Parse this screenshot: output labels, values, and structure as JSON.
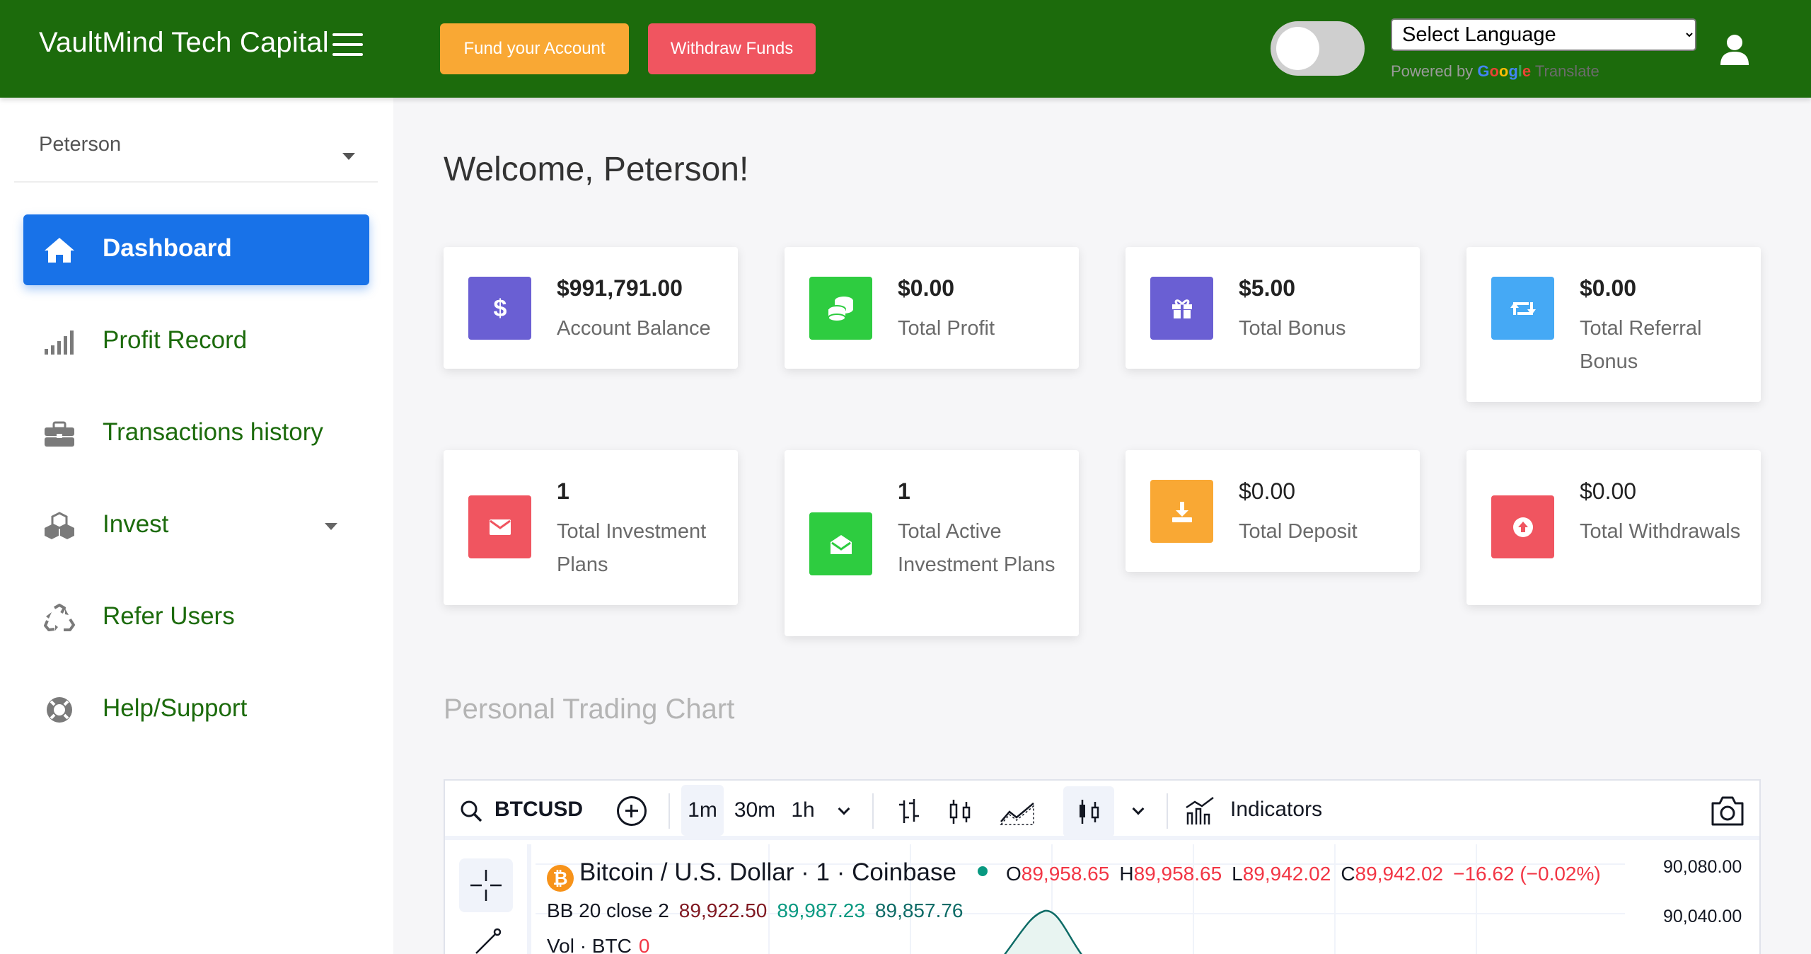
{
  "header": {
    "brand": "VaultMind Tech Capital",
    "fund_button": "Fund your Account",
    "withdraw_button": "Withdraw Funds",
    "language_select": "Select Language",
    "powered_by": "Powered by",
    "google_letters": [
      "G",
      "o",
      "o",
      "g",
      "l",
      "e"
    ],
    "translate_label": "Translate",
    "colors": {
      "bar": "#1c6b0c",
      "fund": "#f9a834",
      "withdraw": "#f05560"
    }
  },
  "sidebar": {
    "user_name": "Peterson",
    "items": [
      {
        "label": "Dashboard",
        "icon": "home-icon",
        "active": true
      },
      {
        "label": "Profit Record",
        "icon": "signal-bars-icon"
      },
      {
        "label": "Transactions history",
        "icon": "briefcase-icon"
      },
      {
        "label": "Invest",
        "icon": "cubes-icon",
        "has_submenu": true
      },
      {
        "label": "Refer Users",
        "icon": "recycle-icon"
      },
      {
        "label": "Help/Support",
        "icon": "life-ring-icon"
      }
    ],
    "colors": {
      "active_bg": "#1872e8",
      "item_text": "#1c6b0c"
    }
  },
  "main": {
    "welcome": "Welcome, Peterson!",
    "cards": [
      {
        "value": "$991,791.00",
        "label": "Account Balance",
        "icon": "dollar-icon",
        "color": "#6a5fd3"
      },
      {
        "value": "$0.00",
        "label": "Total Profit",
        "icon": "coins-icon",
        "color": "#2ecc40"
      },
      {
        "value": "$5.00",
        "label": "Total Bonus",
        "icon": "gift-icon",
        "color": "#6a5fd3"
      },
      {
        "value": "$0.00",
        "label": "Total Referral Bonus",
        "icon": "retweet-icon",
        "color": "#45a9f5"
      },
      {
        "value": "1",
        "label": "Total Investment Plans",
        "icon": "envelope-icon",
        "color": "#f05560"
      },
      {
        "value": "1",
        "label": "Total Active Investment Plans",
        "icon": "envelope-open-icon",
        "color": "#2ecc40"
      },
      {
        "value": "$0.00",
        "label": "Total Deposit",
        "icon": "download-icon",
        "color": "#f9a834"
      },
      {
        "value": "$0.00",
        "label": "Total Withdrawals",
        "icon": "arrow-circle-up-icon",
        "color": "#f05560"
      }
    ],
    "chart_section_title": "Personal Trading Chart"
  },
  "trading_widget": {
    "symbol": "BTCUSD",
    "intervals": [
      "1m",
      "30m",
      "1h"
    ],
    "selected_interval": "1m",
    "indicators_label": "Indicators",
    "pair_title": "Bitcoin / U.S. Dollar · 1 · Coinbase",
    "coin_badge": "₿",
    "ohlc": [
      {
        "k": "O",
        "v": "89,958.65"
      },
      {
        "k": "H",
        "v": "89,958.65"
      },
      {
        "k": "L",
        "v": "89,942.02"
      },
      {
        "k": "C",
        "v": "89,942.02"
      }
    ],
    "change": "−16.62 (−0.02%)",
    "bb_label": "BB 20 close 2",
    "bb_values": [
      "89,922.50",
      "89,987.23",
      "89,857.76"
    ],
    "vol_label": "Vol · BTC",
    "vol_value": "0",
    "price_scale": [
      "90,080.00",
      "90,040.00"
    ]
  }
}
